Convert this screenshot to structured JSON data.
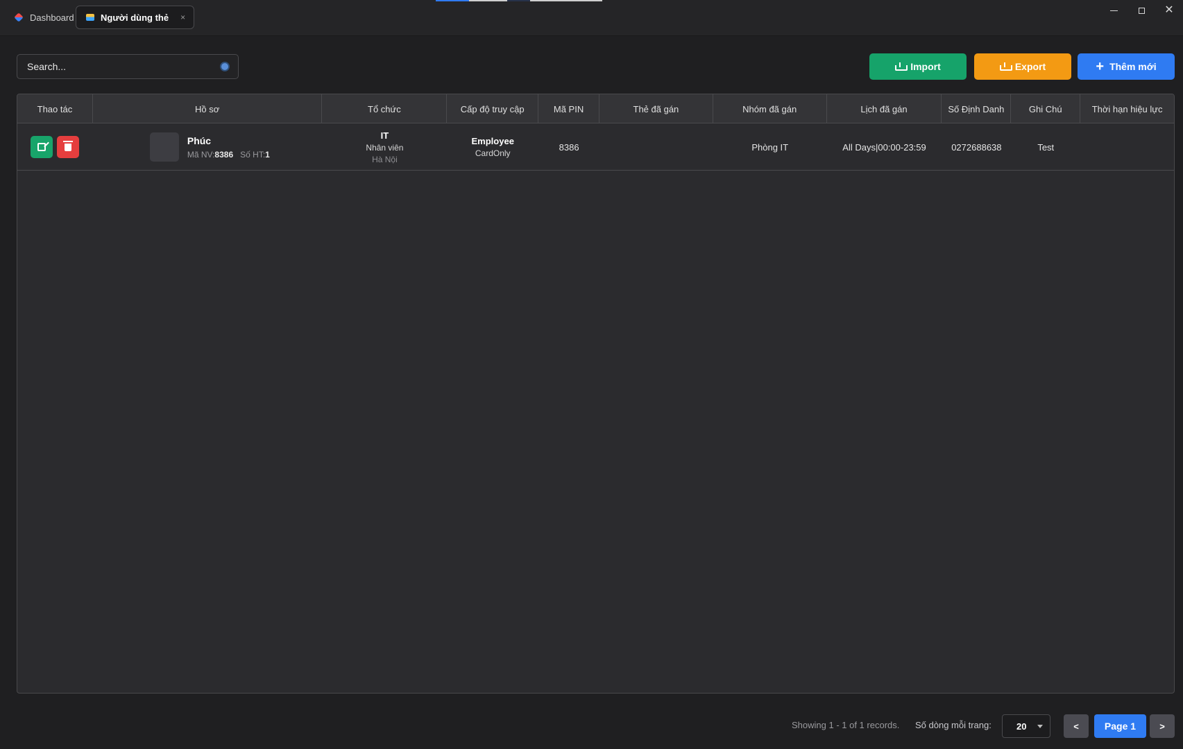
{
  "window": {
    "tabs": [
      {
        "label": "Dashboard",
        "icon": "cube-icon"
      },
      {
        "label": "Người dùng thẻ",
        "icon": "card-icon",
        "active": true,
        "close": "×"
      }
    ],
    "controls": {
      "minimize": "minimize-icon",
      "maximize": "maximize-icon",
      "close": "✕"
    }
  },
  "toolbar": {
    "search_placeholder": "Search...",
    "import_label": "Import",
    "export_label": "Export",
    "add_label": "Thêm mới"
  },
  "table": {
    "columns": [
      "Thao tác",
      "Hồ sơ",
      "Tổ chức",
      "Cấp độ truy cập",
      "Mã PIN",
      "Thẻ đã gán",
      "Nhóm đã gán",
      "Lịch đã gán",
      "Số Định Danh",
      "Ghi Chú",
      "Thời hạn hiệu lực"
    ],
    "rows": [
      {
        "name": "Phúc",
        "employee_label": "Mã NV:",
        "employee_id": "8386",
        "system_label": "Số HT:",
        "system_no": "1",
        "org_department": "IT",
        "org_position": "Nhân viên",
        "org_location": "Hà Nội",
        "access_level": "Employee",
        "access_mode": "CardOnly",
        "pin": "8386",
        "card": "",
        "group": "Phòng IT",
        "schedule": "All Days|00:00-23:59",
        "id_number": "0272688638",
        "note": "Test",
        "validity": ""
      }
    ]
  },
  "footer": {
    "showing": "Showing 1 - 1 of 1 records.",
    "rows_per_page_label": "Số dòng mỗi trang:",
    "rows_per_page": "20",
    "prev": "<",
    "page": "Page 1",
    "next": ">"
  },
  "colors": {
    "import": "#16a36a",
    "export": "#f39a13",
    "add": "#2f7bf2",
    "delete": "#e53e3e",
    "background": "#1f1f21"
  }
}
